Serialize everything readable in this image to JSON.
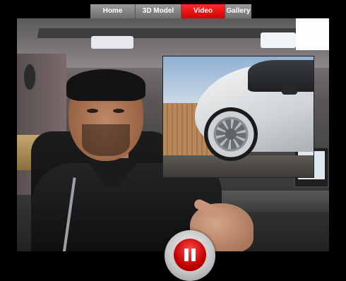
{
  "nav": {
    "items": [
      {
        "label": "Home",
        "active": false
      },
      {
        "label": "3D Model",
        "active": false
      },
      {
        "label": "Video",
        "active": true
      },
      {
        "label": "Gallery",
        "active": false
      }
    ]
  },
  "colors": {
    "nav_bg": "#808080",
    "nav_active": "#e60000",
    "control_red": "#c30000"
  },
  "icons": {
    "pause": "pause-icon"
  }
}
